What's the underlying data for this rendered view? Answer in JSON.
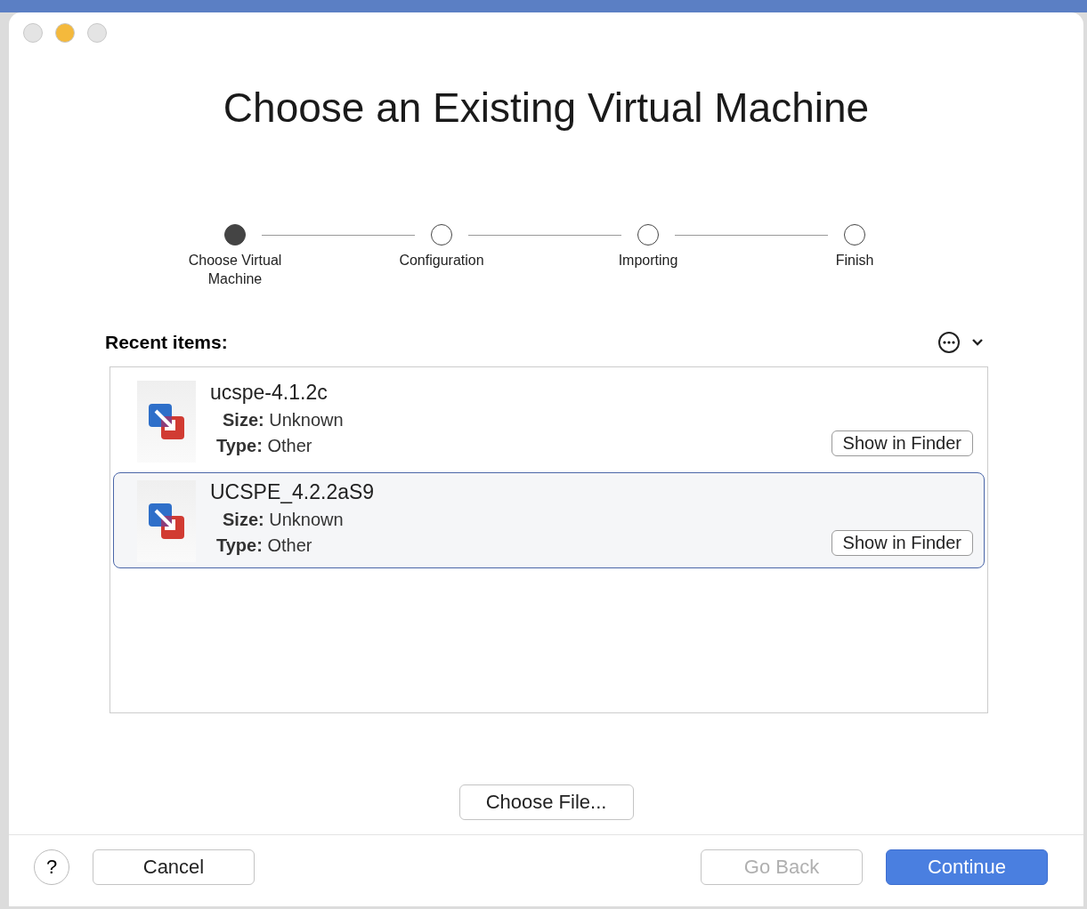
{
  "window": {
    "title": "Choose an Existing Virtual Machine"
  },
  "steps": [
    {
      "label": "Choose Virtual Machine",
      "selected": true
    },
    {
      "label": "Configuration",
      "selected": false
    },
    {
      "label": "Importing",
      "selected": false
    },
    {
      "label": "Finish",
      "selected": false
    }
  ],
  "recent": {
    "heading": "Recent items:",
    "items": [
      {
        "name": "ucspe-4.1.2c",
        "size_label": "Size:",
        "size": "Unknown",
        "type_label": "Type:",
        "type": "Other",
        "button": "Show in Finder",
        "selected": false
      },
      {
        "name": "UCSPE_4.2.2aS9",
        "size_label": "Size:",
        "size": "Unknown",
        "type_label": "Type:",
        "type": "Other",
        "button": "Show in Finder",
        "selected": true
      }
    ]
  },
  "choose_file": "Choose File...",
  "footer": {
    "help": "?",
    "buttons": [
      {
        "label": "Cancel",
        "kind": "normal",
        "disabled": false
      },
      {
        "label": "Go Back",
        "kind": "normal",
        "disabled": true
      },
      {
        "label": "Continue",
        "kind": "primary",
        "disabled": false
      }
    ]
  }
}
